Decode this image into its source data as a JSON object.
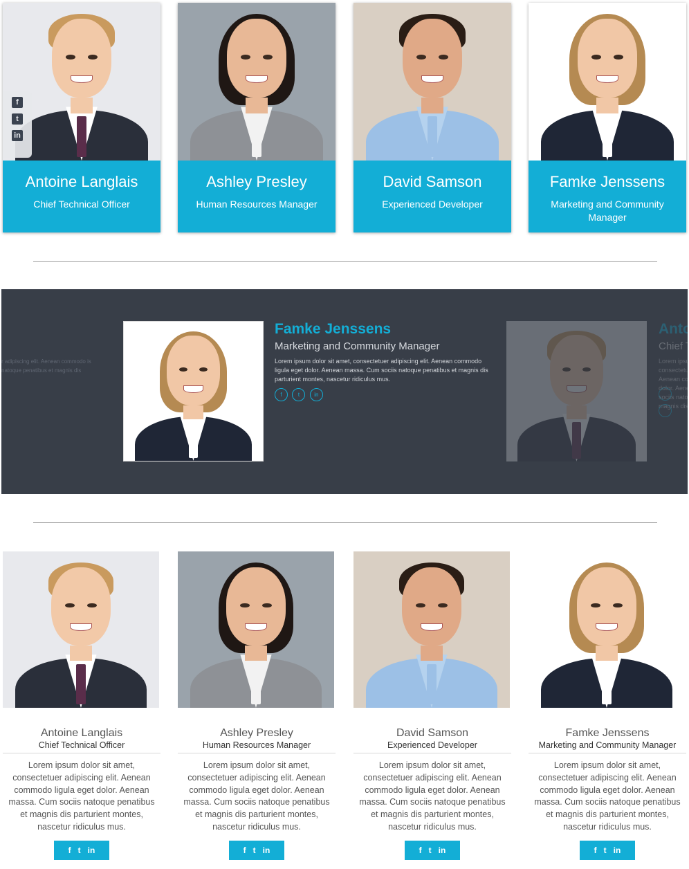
{
  "members": [
    {
      "name": "Antoine Langlais",
      "role": "Chief Technical Officer",
      "bio": "Lorem ipsum dolor sit amet, consectetuer adipiscing elit. Aenean commodo ligula eget dolor. Aenean massa. Cum sociis natoque penatibus et magnis dis parturient montes, nascetur ridiculus mus.",
      "photo_bg": "#e8e9ed",
      "skin": "#f2c9a8",
      "hair": "#c99a5e",
      "suit": "#2a2f3a",
      "shirt": "#ffffff",
      "tie": "#5a2d4a"
    },
    {
      "name": "Ashley Presley",
      "role": "Human Resources Manager",
      "bio": "Lorem ipsum dolor sit amet, consectetuer adipiscing elit. Aenean commodo ligula eget dolor. Aenean massa. Cum sociis natoque penatibus et magnis dis parturient montes, nascetur ridiculus mus.",
      "photo_bg": "#9aa3ab",
      "skin": "#e8b896",
      "hair": "#1f1714",
      "suit": "#8e9196",
      "shirt": "#f2f2f2",
      "tie": "#f2f2f2"
    },
    {
      "name": "David Samson",
      "role": "Experienced Developer",
      "bio": "Lorem ipsum dolor sit amet, consectetuer adipiscing elit. Aenean commodo ligula eget dolor. Aenean massa. Cum sociis natoque penatibus et magnis dis parturient montes, nascetur ridiculus mus.",
      "photo_bg": "#d9cfc3",
      "skin": "#e0a987",
      "hair": "#2a1d15",
      "suit": "#9cc0e6",
      "shirt": "#b5d2ee",
      "tie": "#9cc0e6"
    },
    {
      "name": "Famke Jenssens",
      "role": "Marketing and Community Manager",
      "bio": "Lorem ipsum dolor sit amet, consectetuer adipiscing elit. Aenean commodo ligula eget dolor. Aenean massa. Cum sociis natoque penatibus et magnis dis parturient montes, nascetur ridiculus mus.",
      "photo_bg": "#ffffff",
      "skin": "#f1c7a6",
      "hair": "#b58a52",
      "suit": "#1f2636",
      "shirt": "#ffffff",
      "tie": "#ffffff"
    }
  ],
  "social_icons": {
    "facebook": "f",
    "twitter": "t",
    "linkedin": "in"
  },
  "slider": {
    "active": {
      "name": "Famke Jenssens",
      "role": "Marketing and Community Manager",
      "bio": "Lorem ipsum dolor sit amet, consectetuer adipiscing elit. Aenean commodo ligula eget dolor. Aenean massa. Cum sociis natoque penatibus et magnis dis parturient montes, nascetur ridiculus mus."
    },
    "prev_bio_fragment": "r adipiscing elit. Aenean commodo is natoque penatibus et magnis dis",
    "next": {
      "name": "Antoine Langlais",
      "role": "Chief Technical Officer",
      "bio": "Lorem ipsum dolor sit amet, consectetuer adipiscing elit. Aenean commodo ligula eget dolor. Aenean massa. Cum sociis natoque penatibus et magnis dis parturient montes"
    }
  },
  "colors": {
    "accent": "#13aed6",
    "slider_bg": "#383e48",
    "divider": "#9a9a9a"
  }
}
